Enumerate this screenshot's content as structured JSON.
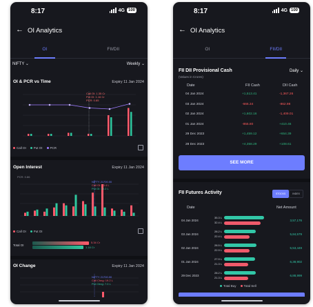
{
  "left": {
    "status": {
      "time": "8:17",
      "network": "4G",
      "battery": "100"
    },
    "header": {
      "title": "OI Analytics"
    },
    "tabs": [
      {
        "label": "OI"
      },
      {
        "label": "FII/DII"
      }
    ],
    "filters": {
      "symbol": "NIFTY",
      "period": "Weekly"
    },
    "oi_pcr": {
      "title": "OI & PCR vs Time",
      "expiry": "Expiry 11 Jan 2024",
      "tooltip": [
        "Call OI: 1.35 Cr",
        "Put OI: 1.16 Cr",
        "PCR: 0.85"
      ],
      "legend": [
        "Call OI",
        "Put OI",
        "PCR"
      ]
    },
    "open_interest": {
      "title": "Open Interest",
      "expiry": "Expiry 11 Jan 2024",
      "pcr_label": "PCR: 0.86",
      "tooltip": [
        "NIFTY 21700.00",
        "Call OI: 23.4 L",
        "Put OI: 10.2 L"
      ],
      "legend": [
        "Call OI",
        "Put OI"
      ],
      "total_label": "Total OI",
      "total_call": "5.34 Cr",
      "total_put": "1.18 Cr"
    },
    "oi_change": {
      "title": "OI Change",
      "expiry": "Expiry 11 Jan 2024",
      "tooltip": [
        "NIFTY 21700.00",
        "Call Chng: 19.2 L",
        "Put Chng: 7.0 L"
      ]
    },
    "colors": {
      "call": "#ff5a6b",
      "put": "#2fc79f",
      "pcr": "#9d7bff",
      "accent": "#6d7dff"
    }
  },
  "right": {
    "status": {
      "time": "8:17",
      "network": "4G",
      "battery": "100"
    },
    "header": {
      "title": "OI Analytics"
    },
    "tabs": [
      {
        "label": "OI"
      },
      {
        "label": "FII/DII"
      }
    ],
    "provisional": {
      "title": "FII DII Provisional Cash",
      "subtitle": "(Values in Crores)",
      "period": "Daily",
      "columns": [
        "Date",
        "FII Cash",
        "DII Cash"
      ],
      "rows": [
        {
          "date": "04 Jan 2024",
          "fii": "+1,513.41",
          "dii": "-1,367.26"
        },
        {
          "date": "03 Jan 2024",
          "fii": "-666.34",
          "dii": "-862.98"
        },
        {
          "date": "02 Jan 2024",
          "fii": "+1,602.16",
          "dii": "-1,409.01"
        },
        {
          "date": "01 Jan 2024",
          "fii": "-855.80",
          "dii": "+410.46"
        },
        {
          "date": "29 Dec 2023",
          "fii": "+1,459.12",
          "dii": "+654.39"
        },
        {
          "date": "28 Dec 2023",
          "fii": "+4,358.29",
          "dii": "+108.61"
        }
      ],
      "see_more": "SEE MORE"
    },
    "futures": {
      "title": "FII Futures Activity",
      "toggles": [
        "STOCKS",
        "INDEX"
      ],
      "columns": [
        "Date",
        "Net Amount"
      ],
      "rows": [
        {
          "date": "04 Jan 2024",
          "buy": "35.3 L",
          "sell": "32.4 L",
          "net": "3,57,176",
          "buy_frac": 0.93,
          "sell_frac": 0.85
        },
        {
          "date": "03 Jan 2024",
          "buy": "28.2 L",
          "sell": "22.4 L",
          "net": "5,84,579",
          "buy_frac": 0.74,
          "sell_frac": 0.59
        },
        {
          "date": "02 Jan 2024",
          "buy": "28.5 L",
          "sell": "22.9 L",
          "net": "5,53,449",
          "buy_frac": 0.75,
          "sell_frac": 0.6
        },
        {
          "date": "01 Jan 2024",
          "buy": "27.9 L",
          "sell": "21.3 L",
          "net": "6,38,902",
          "buy_frac": 0.73,
          "sell_frac": 0.56
        },
        {
          "date": "29 Dec 2023",
          "buy": "28.2 L",
          "sell": "21.3 L",
          "net": "6,88,999",
          "buy_frac": 0.74,
          "sell_frac": 0.56
        }
      ],
      "legend": [
        "Total Buy",
        "Total Sell"
      ]
    }
  },
  "chart_data": [
    {
      "type": "bar",
      "title": "OI & PCR vs Time",
      "series": [
        {
          "name": "Call OI",
          "values": [
            0.1,
            0.1,
            0.15,
            0.1,
            1.0,
            1.35
          ]
        },
        {
          "name": "Put OI",
          "values": [
            0.1,
            0.1,
            0.15,
            0.1,
            0.9,
            1.16
          ]
        },
        {
          "name": "PCR",
          "values": [
            1.5,
            1.5,
            1.5,
            1.35,
            1.3,
            1.55
          ]
        }
      ],
      "ylim": [
        0,
        2.0
      ]
    },
    {
      "type": "bar",
      "title": "Open Interest",
      "series": [
        {
          "name": "Call OI",
          "values": [
            3,
            5,
            4,
            8,
            12,
            9,
            14,
            22,
            30,
            7,
            6,
            10
          ]
        },
        {
          "name": "Put OI",
          "values": [
            4,
            6,
            7,
            12,
            10,
            20,
            11,
            9,
            8,
            5,
            4,
            3
          ]
        }
      ]
    }
  ]
}
